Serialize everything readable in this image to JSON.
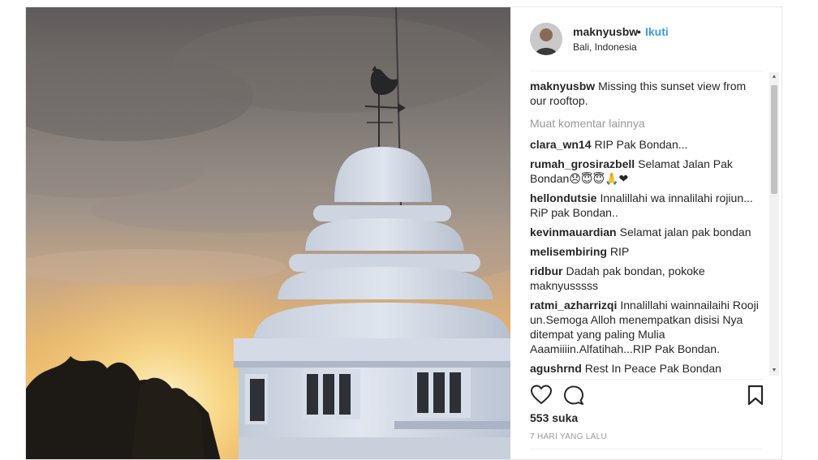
{
  "post": {
    "username": "maknyusbw",
    "dot": "•",
    "follow_label": "Ikuti",
    "location": "Bali, Indonesia",
    "caption": "Missing this sunset view from our rooftop.",
    "load_more": "Muat komentar lainnya",
    "likes": "553 suka",
    "time": "7 HARI YANG LALU"
  },
  "comments": [
    {
      "user": "clara_wn14",
      "text": "RIP Pak Bondan..."
    },
    {
      "user": "rumah_grosirazbell",
      "text": "Selamat Jalan Pak Bondan😞😇😇🙏❤"
    },
    {
      "user": "hellondutsie",
      "text": "Innalillahi wa innalilahi rojiun... RiP pak Bondan.."
    },
    {
      "user": "kevinmauardian",
      "text": "Selamat jalan pak bondan"
    },
    {
      "user": "melisembiring",
      "text": "RIP"
    },
    {
      "user": "ridbur",
      "text": "Dadah pak bondan, pokoke maknyusssss"
    },
    {
      "user": "ratmi_azharrizqi",
      "text": "Innalillahi wainnailaihi Rooji un.Semoga Alloh menempatkan disisi Nya ditempat yang paling Mulia Aaamiiiin.Alfatihah...RIP Pak Bondan."
    },
    {
      "user": "agushrnd",
      "text": "Rest In Peace Pak Bondan"
    }
  ],
  "icons": {
    "like": "heart-icon",
    "comment": "comment-icon",
    "save": "bookmark-icon"
  },
  "colors": {
    "link": "#3897f0",
    "muted": "#999999"
  }
}
